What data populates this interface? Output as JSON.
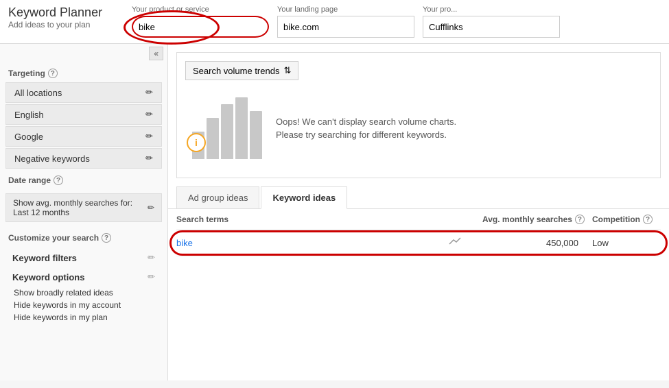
{
  "header": {
    "logo_title": "Keyword Planner",
    "logo_subtitle": "Add ideas to your plan",
    "fields": [
      {
        "label": "Your product or service",
        "value": "bike",
        "name": "product-input",
        "highlighted": true
      },
      {
        "label": "Your landing page",
        "value": "bike.com",
        "name": "landing-page-input",
        "highlighted": false
      },
      {
        "label": "Your pro...",
        "value": "Cufflinks",
        "name": "product-category-input",
        "highlighted": false
      }
    ]
  },
  "sidebar": {
    "collapse_btn_label": "«",
    "targeting_label": "Targeting",
    "targeting_items": [
      {
        "label": "All locations",
        "name": "all-locations-item"
      },
      {
        "label": "English",
        "name": "english-item"
      },
      {
        "label": "Google",
        "name": "google-item"
      },
      {
        "label": "Negative keywords",
        "name": "negative-keywords-item"
      }
    ],
    "date_range_label": "Date range",
    "date_range_text": "Show avg. monthly searches for: Last 12 months",
    "customize_label": "Customize your search",
    "keyword_filters_label": "Keyword filters",
    "keyword_options_label": "Keyword options",
    "keyword_options_sub1": "Show broadly related ideas",
    "keyword_options_sub2": "Hide keywords in my account",
    "keyword_options_sub3": "Hide keywords in my plan"
  },
  "chart": {
    "dropdown_label": "Search volume trends",
    "dropdown_arrow": "⇅",
    "error_message": "Oops! We can't display search volume charts.\nPlease try searching for different keywords.",
    "info_icon": "i",
    "bars": [
      40,
      60,
      80,
      90,
      70
    ]
  },
  "tabs": [
    {
      "label": "Ad group ideas",
      "active": false,
      "name": "ad-group-ideas-tab"
    },
    {
      "label": "Keyword ideas",
      "active": true,
      "name": "keyword-ideas-tab"
    }
  ],
  "table": {
    "col_search": "Search terms",
    "col_avg": "Avg. monthly searches",
    "col_competition": "Competition",
    "rows": [
      {
        "keyword": "bike",
        "avg_searches": "450,000",
        "competition": "Low",
        "highlighted": true
      }
    ]
  },
  "icons": {
    "edit": "✏",
    "trend": "⌇",
    "question": "?"
  }
}
